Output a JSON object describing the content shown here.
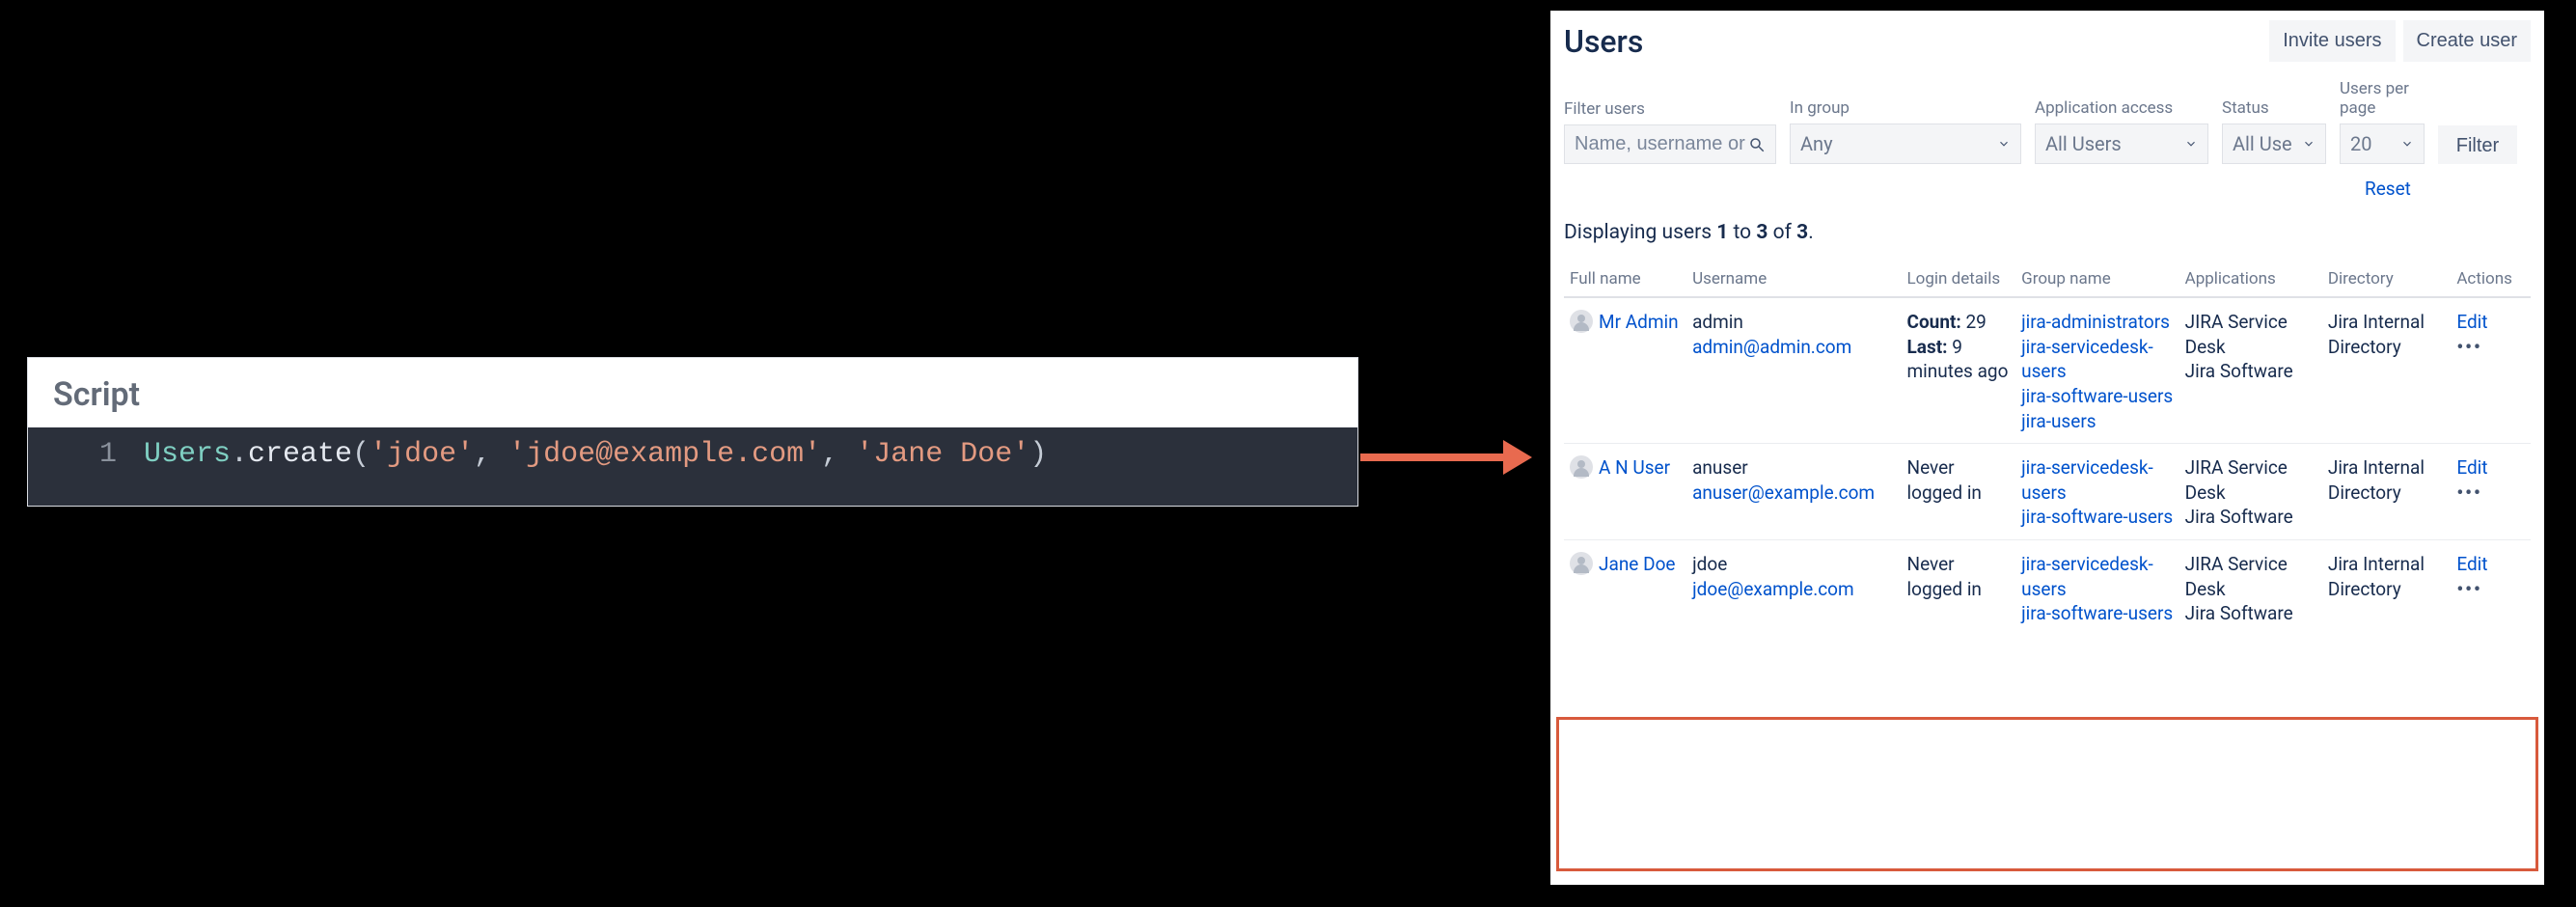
{
  "code_editor": {
    "title": "Script",
    "line_number": "1",
    "tokens": {
      "obj": "Users",
      "dot": ".",
      "fn": "create",
      "open": "(",
      "arg1": "'jdoe'",
      "comma1": ", ",
      "arg2": "'jdoe@example.com'",
      "comma2": ", ",
      "arg3": "'Jane Doe'",
      "close": ")"
    }
  },
  "users_panel": {
    "title": "Users",
    "buttons": {
      "invite": "Invite users",
      "create": "Create user"
    },
    "filters": {
      "filter_users": {
        "label": "Filter users",
        "placeholder": "Name, username or e"
      },
      "in_group": {
        "label": "In group",
        "value": "Any"
      },
      "app_access": {
        "label": "Application access",
        "value": "All Users"
      },
      "status": {
        "label": "Status",
        "value": "All Use"
      },
      "per_page": {
        "label": "Users per page",
        "value": "20"
      },
      "filter_btn": "Filter",
      "reset": "Reset"
    },
    "counts": {
      "prefix": "Displaying users ",
      "from": "1",
      "to_word": " to ",
      "to": "3",
      "of_word": " of ",
      "total": "3",
      "suffix": "."
    },
    "columns": {
      "full_name": "Full name",
      "username": "Username",
      "login": "Login details",
      "group": "Group name",
      "apps": "Applications",
      "directory": "Directory",
      "actions": "Actions"
    },
    "rows": [
      {
        "full_name": "Mr Admin",
        "username": "admin",
        "email": "admin@admin.com",
        "login_count_label": "Count:",
        "login_count": "29",
        "login_last_label": "Last:",
        "login_last": "9 minutes ago",
        "login_never": "",
        "groups": [
          "jira-administrators",
          "jira-servicedesk-users",
          "jira-software-users",
          "jira-users"
        ],
        "apps": [
          "JIRA Service Desk",
          "Jira Software"
        ],
        "directory": "Jira Internal Directory",
        "edit": "Edit"
      },
      {
        "full_name": "A N User",
        "username": "anuser",
        "email": "anuser@example.com",
        "login_never": "Never logged in",
        "groups": [
          "jira-servicedesk-users",
          "jira-software-users"
        ],
        "apps": [
          "JIRA Service Desk",
          "Jira Software"
        ],
        "directory": "Jira Internal Directory",
        "edit": "Edit"
      },
      {
        "full_name": "Jane Doe",
        "username": "jdoe",
        "email": "jdoe@example.com",
        "login_never": "Never logged in",
        "groups": [
          "jira-servicedesk-users",
          "jira-software-users"
        ],
        "apps": [
          "JIRA Service Desk",
          "Jira Software"
        ],
        "directory": "Jira Internal Directory",
        "edit": "Edit"
      }
    ]
  }
}
